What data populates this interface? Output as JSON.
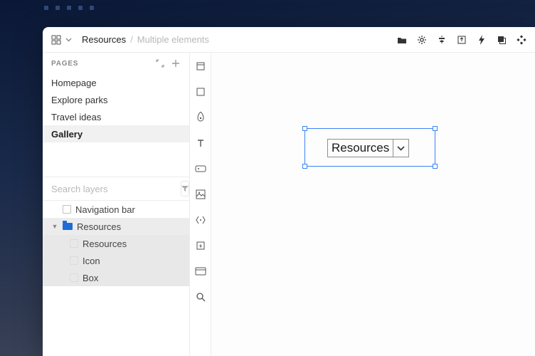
{
  "breadcrumb": {
    "root": "Resources",
    "detail": "Multiple elements"
  },
  "pages": {
    "heading": "PAGES",
    "items": [
      "Homepage",
      "Explore parks",
      "Travel ideas",
      "Gallery"
    ],
    "active_index": 3
  },
  "search": {
    "placeholder": "Search layers"
  },
  "layers": {
    "top": "Navigation bar",
    "group": "Resources",
    "children": [
      "Resources",
      "Icon",
      "Box"
    ]
  },
  "canvas": {
    "dropdown_label": "Resources"
  },
  "icons": {
    "grid": "grid-icon",
    "caret": "chevron-down-icon",
    "folder": "folder-icon",
    "gear": "gear-icon",
    "align_h": "align-center-icon",
    "export": "export-icon",
    "bolt": "bolt-icon",
    "layers": "layers-icon",
    "components": "components-icon",
    "expand": "expand-icon",
    "plus": "plus-icon",
    "filter": "filter-icon",
    "tools": [
      "cursor",
      "frame",
      "pen",
      "text",
      "button",
      "image",
      "breakpoints",
      "bolt",
      "card",
      "search"
    ]
  }
}
